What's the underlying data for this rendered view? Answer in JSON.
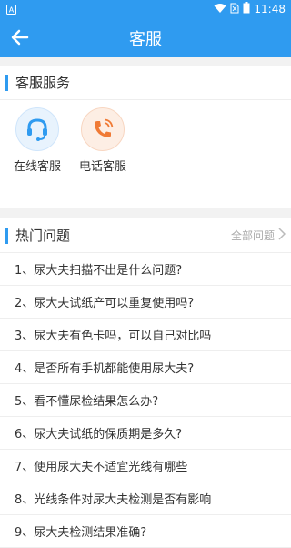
{
  "status": {
    "time": "11:48"
  },
  "appbar": {
    "title": "客服"
  },
  "service": {
    "title": "客服服务",
    "items": [
      {
        "label": "在线客服",
        "icon": "headset-icon",
        "color": "#2f9bf0"
      },
      {
        "label": "电话客服",
        "icon": "phone-icon",
        "color": "#f07a35"
      }
    ]
  },
  "hot": {
    "title": "热门问题",
    "more": "全部问题",
    "questions": [
      "1、尿大夫扫描不出是什么问题?",
      "2、尿大夫试纸产可以重复使用吗?",
      "3、尿大夫有色卡吗，可以自己对比吗",
      "4、是否所有手机都能使用尿大夫?",
      "5、看不懂尿检结果怎么办?",
      "6、尿大夫试纸的保质期是多久?",
      "7、使用尿大夫不适宜光线有哪些",
      "8、光线条件对尿大夫检测是否有影响",
      "9、尿大夫检测结果准确?"
    ]
  }
}
